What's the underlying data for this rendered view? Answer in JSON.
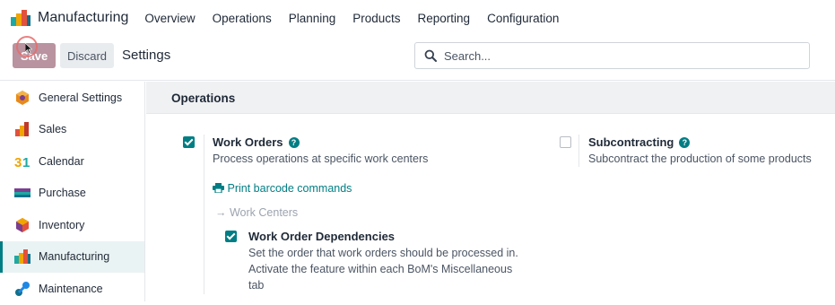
{
  "app": {
    "name": "Manufacturing",
    "menu": [
      "Overview",
      "Operations",
      "Planning",
      "Products",
      "Reporting",
      "Configuration"
    ]
  },
  "control_panel": {
    "save_label": "Save",
    "discard_label": "Discard",
    "title": "Settings",
    "search_placeholder": "Search..."
  },
  "sidebar": {
    "items": [
      {
        "label": "General Settings",
        "icon": "general-settings-icon"
      },
      {
        "label": "Sales",
        "icon": "sales-icon"
      },
      {
        "label": "Calendar",
        "icon": "calendar-icon"
      },
      {
        "label": "Purchase",
        "icon": "purchase-icon"
      },
      {
        "label": "Inventory",
        "icon": "inventory-icon"
      },
      {
        "label": "Manufacturing",
        "icon": "manufacturing-icon",
        "active": true
      },
      {
        "label": "Maintenance",
        "icon": "maintenance-icon"
      }
    ]
  },
  "section": {
    "title": "Operations",
    "work_orders": {
      "title": "Work Orders",
      "description": "Process operations at specific work centers",
      "checked": true,
      "print_link": "Print barcode commands",
      "work_centers_link": "Work Centers"
    },
    "subcontracting": {
      "title": "Subcontracting",
      "description": "Subcontract the production of some products",
      "checked": false
    },
    "dependencies": {
      "title": "Work Order Dependencies",
      "description_lines": [
        "Set the order that work orders should be processed in.",
        "Activate the feature within each BoM's Miscellaneous",
        "tab"
      ],
      "checked": true
    }
  },
  "colors": {
    "accent": "#017e84",
    "save_button": "#b9939f",
    "section_header_bg": "#f0f1f3"
  }
}
